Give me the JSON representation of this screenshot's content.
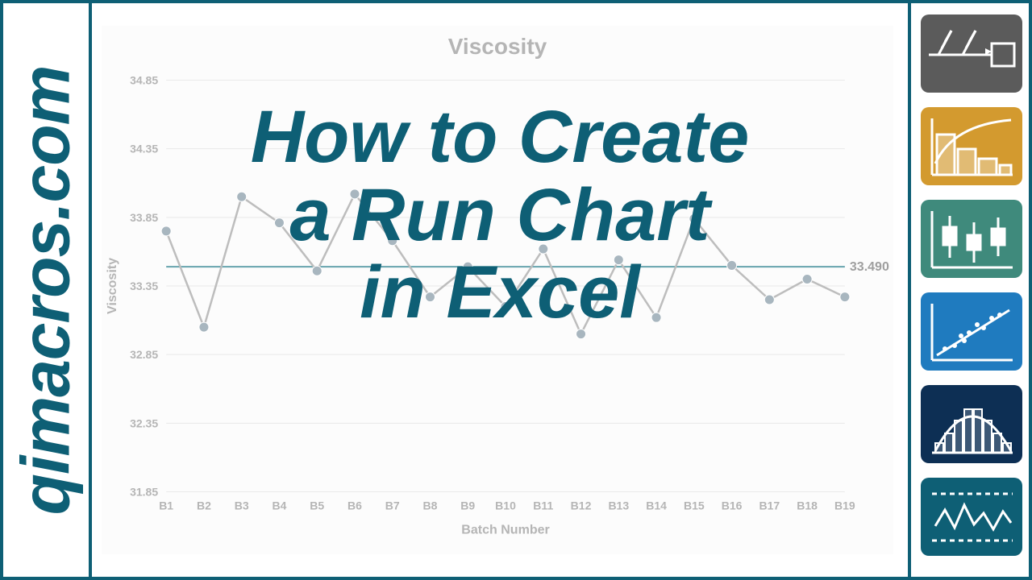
{
  "brand": {
    "site": "qimacros.com"
  },
  "headline": {
    "line1": "How to Create",
    "line2": "a Run Chart",
    "line3": "in Excel"
  },
  "icons": {
    "fishbone_color": "#5b5b5b",
    "pareto_color": "#d39a2f",
    "boxplot_color": "#3f8a7c",
    "scatter_color": "#1f7bbf",
    "histogram_color": "#0d2f54",
    "runchart_color": "#0e5f75"
  },
  "chart_data": {
    "type": "line",
    "title": "Viscosity",
    "xlabel": "Batch Number",
    "ylabel": "Viscosity",
    "categories": [
      "B1",
      "B2",
      "B3",
      "B4",
      "B5",
      "B6",
      "B7",
      "B8",
      "B9",
      "B10",
      "B11",
      "B12",
      "B13",
      "B14",
      "B15",
      "B16",
      "B17",
      "B18",
      "B19"
    ],
    "values": [
      33.75,
      33.05,
      34.0,
      33.81,
      33.46,
      34.02,
      33.68,
      33.27,
      33.49,
      33.2,
      33.62,
      33.0,
      33.54,
      33.12,
      33.84,
      33.5,
      33.25,
      33.4,
      33.27
    ],
    "median": 33.49,
    "median_label": "33.490",
    "y_ticks": [
      31.85,
      32.35,
      32.85,
      33.35,
      33.85,
      34.35,
      34.85
    ],
    "ylim": [
      31.85,
      34.85
    ]
  }
}
